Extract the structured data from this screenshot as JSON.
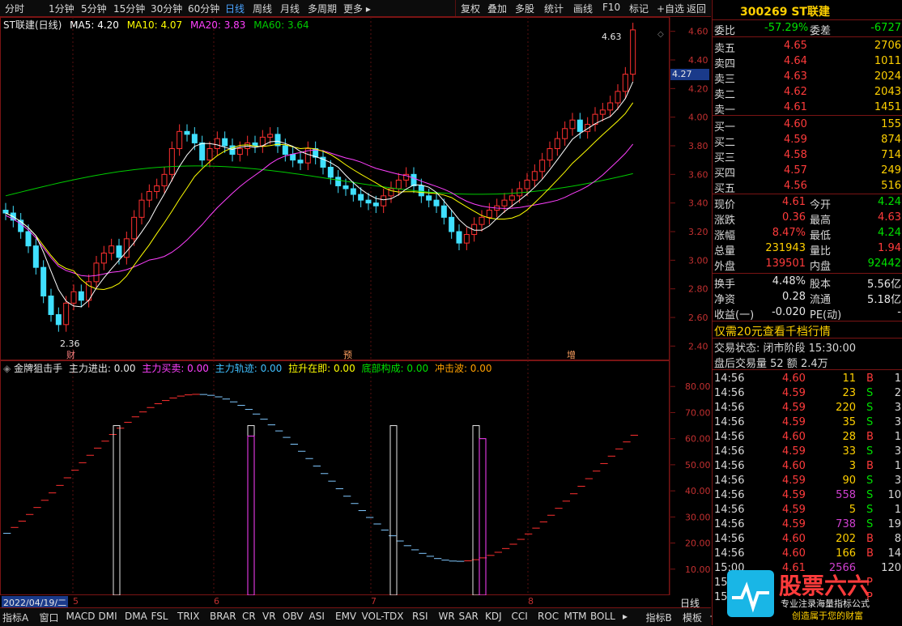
{
  "toolbar": {
    "items": [
      "分时",
      "1分钟",
      "5分钟",
      "15分钟",
      "30分钟",
      "60分钟",
      "日线",
      "周线",
      "月线",
      "多周期",
      "更多 ▸"
    ],
    "right_items": [
      "复权",
      "叠加",
      "多股",
      "统计",
      "画线",
      "F10",
      "标记",
      "+自选",
      "返回"
    ],
    "active": "日线"
  },
  "chart": {
    "title": "ST联建(日线)",
    "ma5": "MA5: 4.20",
    "ma10": "MA10: 4.07",
    "ma20": "MA20: 3.83",
    "ma60": "MA60: 3.64",
    "price_ticks": [
      "4.60",
      "4.40",
      "4.20",
      "4.00",
      "3.80",
      "3.60",
      "3.40",
      "3.20",
      "3.00",
      "2.80",
      "2.60",
      "2.40"
    ],
    "current_price_tag": "4.27",
    "high_label": "4.63",
    "low_label": "2.36",
    "markers": [
      "财",
      "预",
      "增"
    ],
    "colors": {
      "ma5": "#ffffff",
      "ma10": "#ffff00",
      "ma20": "#ff40ff",
      "ma60": "#00cc00",
      "up": "#ff3030",
      "down": "#40e0ff",
      "grid": "#7a1414"
    }
  },
  "indicator": {
    "name": "金牌狙击手",
    "items": [
      {
        "label": "主力进出: 0.00",
        "color": "#e6e6e6"
      },
      {
        "label": "主力买卖: 0.00",
        "color": "#ff40ff"
      },
      {
        "label": "主力轨迹: 0.00",
        "color": "#40c0ff"
      },
      {
        "label": "拉升在即: 0.00",
        "color": "#ffff00"
      },
      {
        "label": "底部构成: 0.00",
        "color": "#00e000"
      },
      {
        "label": "冲击波: 0.00",
        "color": "#ffa000"
      }
    ],
    "ticks": [
      "80.00",
      "70.00",
      "60.00",
      "50.00",
      "40.00",
      "30.00",
      "20.00",
      "10.00"
    ]
  },
  "date_bar": {
    "date": "2022/04/19/二",
    "months": [
      "5",
      "6",
      "7",
      "8"
    ],
    "period": "日线"
  },
  "bottom_tabs": [
    "指标A",
    "窗口",
    "MACD",
    "DMI",
    "DMA",
    "FSL",
    "TRIX",
    "BRAR",
    "CR",
    "VR",
    "OBV",
    "ASI",
    "EMV",
    "VOL-TDX",
    "RSI",
    "WR",
    "SAR",
    "KDJ",
    "CCI",
    "ROC",
    "MTM",
    "BOLL",
    "▸",
    "指标B",
    "模板",
    "+",
    "—"
  ],
  "quote": {
    "code_name": "300269 ST联建",
    "weibi_label": "委比",
    "weibi": "-57.29%",
    "weicha_label": "委差",
    "weicha": "-6727",
    "sells": [
      {
        "label": "卖五",
        "price": "4.65",
        "vol": "2706"
      },
      {
        "label": "卖四",
        "price": "4.64",
        "vol": "1011"
      },
      {
        "label": "卖三",
        "price": "4.63",
        "vol": "2024"
      },
      {
        "label": "卖二",
        "price": "4.62",
        "vol": "2043"
      },
      {
        "label": "卖一",
        "price": "4.61",
        "vol": "1451"
      }
    ],
    "buys": [
      {
        "label": "买一",
        "price": "4.60",
        "vol": "155"
      },
      {
        "label": "买二",
        "price": "4.59",
        "vol": "874"
      },
      {
        "label": "买三",
        "price": "4.58",
        "vol": "714"
      },
      {
        "label": "买四",
        "price": "4.57",
        "vol": "249"
      },
      {
        "label": "买五",
        "price": "4.56",
        "vol": "516"
      }
    ],
    "stats": [
      {
        "l1": "现价",
        "v1": "4.61",
        "c1": "red",
        "l2": "今开",
        "v2": "4.24",
        "c2": "grn"
      },
      {
        "l1": "涨跌",
        "v1": "0.36",
        "c1": "red",
        "l2": "最高",
        "v2": "4.63",
        "c2": "red"
      },
      {
        "l1": "涨幅",
        "v1": "8.47%",
        "c1": "red",
        "l2": "最低",
        "v2": "4.24",
        "c2": "grn"
      },
      {
        "l1": "总量",
        "v1": "231943",
        "c1": "yel",
        "l2": "量比",
        "v2": "1.94",
        "c2": "red"
      },
      {
        "l1": "外盘",
        "v1": "139501",
        "c1": "red",
        "l2": "内盘",
        "v2": "92442",
        "c2": "grn"
      }
    ],
    "stats2": [
      {
        "l1": "换手",
        "v1": "4.48%",
        "l2": "股本",
        "v2": "5.56亿"
      },
      {
        "l1": "净资",
        "v1": "0.28",
        "l2": "流通",
        "v2": "5.18亿"
      },
      {
        "l1": "收益(一)",
        "v1": "-0.020",
        "l2": "PE(动)",
        "v2": "-"
      }
    ],
    "promo": "仅需20元查看千档行情",
    "trade_status": "交易状态: 闭市阶段 15:30:00",
    "after_hours": "盘后交易量 52 额 2.4万",
    "ticks": [
      {
        "t": "14:56",
        "p": "4.60",
        "v": "11",
        "vc": "yel",
        "bs": "B",
        "n": "1"
      },
      {
        "t": "14:56",
        "p": "4.59",
        "v": "23",
        "vc": "yel",
        "bs": "S",
        "n": "2"
      },
      {
        "t": "14:56",
        "p": "4.59",
        "v": "220",
        "vc": "yel",
        "bs": "S",
        "n": "3"
      },
      {
        "t": "14:56",
        "p": "4.59",
        "v": "35",
        "vc": "yel",
        "bs": "S",
        "n": "3"
      },
      {
        "t": "14:56",
        "p": "4.60",
        "v": "28",
        "vc": "yel",
        "bs": "B",
        "n": "1"
      },
      {
        "t": "14:56",
        "p": "4.59",
        "v": "33",
        "vc": "yel",
        "bs": "S",
        "n": "3"
      },
      {
        "t": "14:56",
        "p": "4.60",
        "v": "3",
        "vc": "yel",
        "bs": "B",
        "n": "1"
      },
      {
        "t": "14:56",
        "p": "4.59",
        "v": "90",
        "vc": "yel",
        "bs": "S",
        "n": "3"
      },
      {
        "t": "14:56",
        "p": "4.59",
        "v": "558",
        "vc": "mag",
        "bs": "S",
        "n": "10"
      },
      {
        "t": "14:56",
        "p": "4.59",
        "v": "5",
        "vc": "yel",
        "bs": "S",
        "n": "1"
      },
      {
        "t": "14:56",
        "p": "4.59",
        "v": "738",
        "vc": "mag",
        "bs": "S",
        "n": "19"
      },
      {
        "t": "14:56",
        "p": "4.60",
        "v": "202",
        "vc": "yel",
        "bs": "B",
        "n": "8"
      },
      {
        "t": "14:56",
        "p": "4.60",
        "v": "166",
        "vc": "yel",
        "bs": "B",
        "n": "14"
      },
      {
        "t": "15:00",
        "p": "4.61",
        "v": "2566",
        "vc": "mag",
        "bs": "",
        "n": "120"
      },
      {
        "t": "15:",
        "p": "",
        "v": "",
        "vc": "yel",
        "bs": "P",
        "n": ""
      },
      {
        "t": "15:",
        "p": "",
        "v": "",
        "vc": "yel",
        "bs": "P",
        "n": ""
      }
    ],
    "watermark_title": "股票六六",
    "watermark_sub1": "专业注录海量指标公式",
    "watermark_sub2": "创造属于您的财富"
  }
}
